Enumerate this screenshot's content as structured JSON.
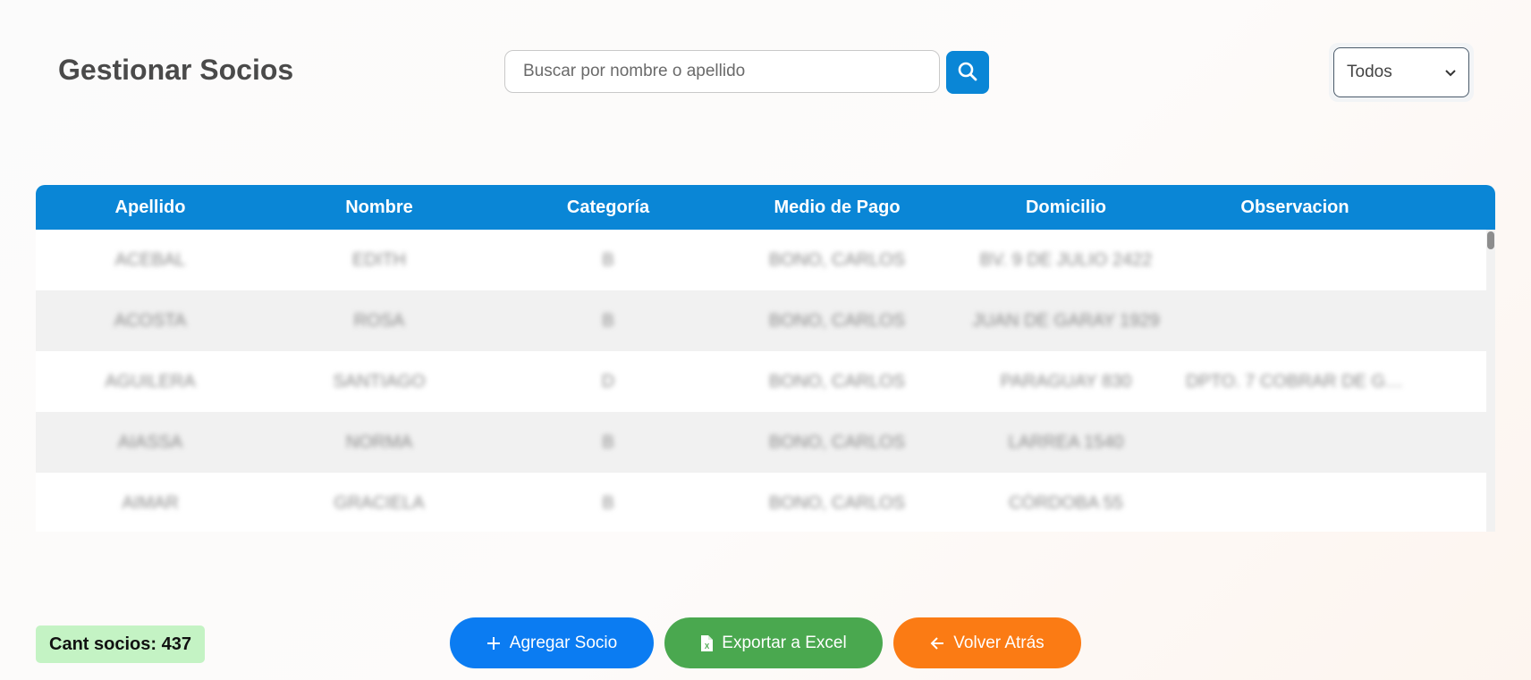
{
  "header": {
    "title": "Gestionar Socios",
    "search": {
      "placeholder": "Buscar por nombre o apellido",
      "value": "",
      "icon": "search-icon"
    },
    "filter": {
      "selected": "Todos"
    }
  },
  "table": {
    "columns": [
      "Apellido",
      "Nombre",
      "Categoría",
      "Medio de Pago",
      "Domicilio",
      "Observacion"
    ],
    "rows": [
      [
        "ACEBAL",
        "EDITH",
        "B",
        "BONO, CARLOS",
        "BV. 9 DE JULIO 2422",
        ""
      ],
      [
        "ACOSTA",
        "ROSA",
        "B",
        "BONO, CARLOS",
        "JUAN DE GARAY 1929",
        ""
      ],
      [
        "AGUILERA",
        "SANTIAGO",
        "D",
        "BONO, CARLOS",
        "PARAGUAY 830",
        "DPTO. 7 COBRAR DE GI..."
      ],
      [
        "AIASSA",
        "NORMA",
        "B",
        "BONO, CARLOS",
        "LARREA 1540",
        ""
      ],
      [
        "AIMAR",
        "GRACIELA",
        "B",
        "BONO, CARLOS",
        "CÓRDOBA 55",
        ""
      ]
    ]
  },
  "footer": {
    "count_label": "Cant socios: 437",
    "add_label": "Agregar Socio",
    "export_label": "Exportar a Excel",
    "back_label": "Volver Atrás"
  },
  "colors": {
    "primary": "#0a86d6",
    "add_button": "#0b7cf2",
    "export_button": "#4aa84f",
    "back_button": "#fb7b14",
    "count_badge": "#c4f3c4"
  }
}
